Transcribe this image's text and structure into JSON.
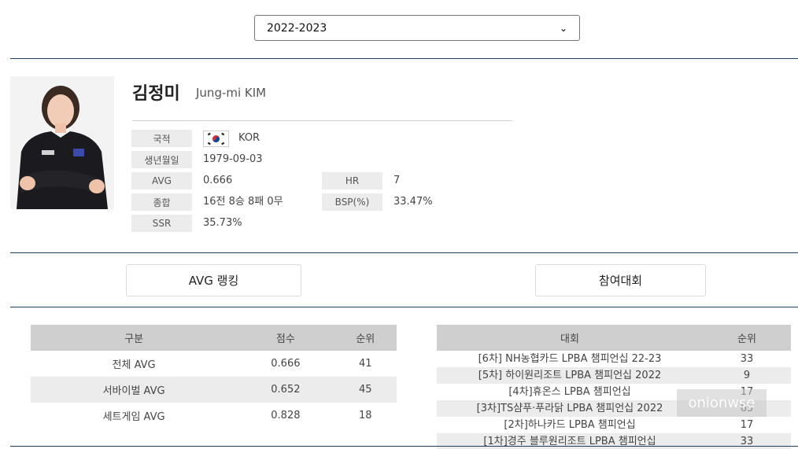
{
  "season": {
    "selected": "2022-2023"
  },
  "player": {
    "name_ko": "김정미",
    "name_en": "Jung-mi KIM"
  },
  "info": {
    "nationality_label": "국적",
    "nationality_value": "KOR",
    "birth_label": "생년월일",
    "birth_value": "1979-09-03",
    "avg_label": "AVG",
    "avg_value": "0.666",
    "hr_label": "HR",
    "hr_value": "7",
    "record_label": "종합",
    "record_value": "16전 8승 8패 0무",
    "bsp_label": "BSP(%)",
    "bsp_value": "33.47%",
    "ssr_label": "SSR",
    "ssr_value": "35.73%"
  },
  "tabs": {
    "avg_ranking": "AVG 랭킹",
    "tournaments": "참여대회"
  },
  "avg_table": {
    "headers": [
      "구분",
      "점수",
      "순위"
    ],
    "rows": [
      [
        "전체 AVG",
        "0.666",
        "41"
      ],
      [
        "서바이벌 AVG",
        "0.652",
        "45"
      ],
      [
        "세트게임 AVG",
        "0.828",
        "18"
      ]
    ]
  },
  "tournament_table": {
    "headers": [
      "대회",
      "순위"
    ],
    "rows": [
      [
        "[6차] NH농협카드 LPBA 챔피언십 22-23",
        "33"
      ],
      [
        "[5차] 하이원리조트 LPBA 챔피언십 2022",
        "9"
      ],
      [
        "[4차]휴온스 LPBA 챔피언십",
        "17"
      ],
      [
        "[3차]TS샴푸·푸라닭 LPBA 챔피언십 2022",
        "65"
      ],
      [
        "[2차]하나카드 LPBA 챔피언십",
        "17"
      ],
      [
        "[1차]경주 블루원리조트 LPBA 챔피언십",
        "33"
      ]
    ]
  },
  "watermark": "onionwse",
  "colors": {
    "rule": "#1f3f5e",
    "header_bg": "#cfcfcf",
    "label_bg": "#ececec"
  }
}
